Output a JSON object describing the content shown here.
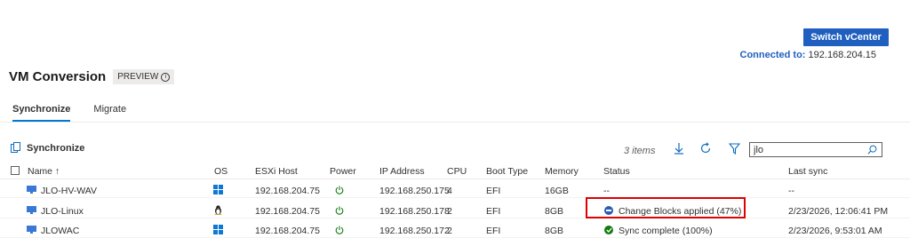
{
  "header": {
    "switch_button_label": "Switch vCenter",
    "connected_label": "Connected to:",
    "connected_value": "192.168.204.15"
  },
  "page": {
    "title": "VM Conversion",
    "badge": "PREVIEW"
  },
  "tabs": [
    {
      "label": "Synchronize",
      "active": true
    },
    {
      "label": "Migrate",
      "active": false
    }
  ],
  "toolbar": {
    "sync_label": "Synchronize",
    "items_count": "3 items",
    "search_value": "jlo"
  },
  "table": {
    "columns": [
      "Name ↑",
      "OS",
      "ESXi Host",
      "Power",
      "IP Address",
      "CPU",
      "Boot Type",
      "Memory",
      "Status",
      "Last sync"
    ],
    "rows": [
      {
        "name": "JLO-HV-WAV",
        "os": "windows",
        "host": "192.168.204.75",
        "power": "on",
        "ip": "192.168.250.175",
        "cpu": "4",
        "boot": "EFI",
        "memory": "16GB",
        "status": "--",
        "status_kind": "none",
        "last_sync": "--"
      },
      {
        "name": "JLO-Linux",
        "os": "linux",
        "host": "192.168.204.75",
        "power": "on",
        "ip": "192.168.250.178",
        "cpu": "2",
        "boot": "EFI",
        "memory": "8GB",
        "status": "Change Blocks applied (47%)",
        "status_kind": "progress",
        "last_sync": "2/23/2026, 12:06:41 PM"
      },
      {
        "name": "JLOWAC",
        "os": "windows",
        "host": "192.168.204.75",
        "power": "on",
        "ip": "192.168.250.172",
        "cpu": "2",
        "boot": "EFI",
        "memory": "8GB",
        "status": "Sync complete (100%)",
        "status_kind": "complete",
        "last_sync": "2/23/2026, 9:53:01 AM"
      }
    ]
  },
  "colors": {
    "accent": "#1f5fbf",
    "highlight": "#e00000",
    "power_on": "#107c10",
    "status_progress": "#2d5bb9",
    "status_complete": "#107c10"
  },
  "icons": {
    "sync": "sync-copy-icon",
    "download": "download-icon",
    "refresh": "refresh-icon",
    "filter": "filter-icon",
    "search": "search-icon",
    "info": "info-icon",
    "vm": "vm-monitor-icon"
  }
}
